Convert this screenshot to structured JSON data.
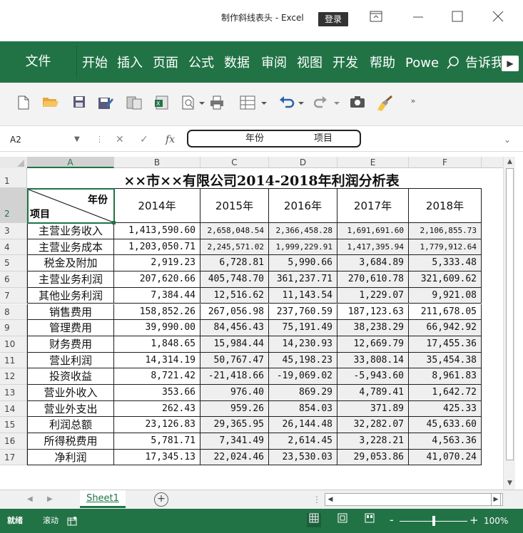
{
  "window": {
    "title": "制作斜线表头 - Excel",
    "login_label": "登录",
    "ribbon_options_icon": "ribbon-display-icon",
    "minimize_icon": "minimize-icon",
    "maximize_icon": "maximize-icon",
    "close_icon": "close-icon"
  },
  "ribbon": {
    "tabs": [
      {
        "label": "文件"
      },
      {
        "label": "开始"
      },
      {
        "label": "插入"
      },
      {
        "label": "页面"
      },
      {
        "label": "公式"
      },
      {
        "label": "数据"
      },
      {
        "label": "审阅"
      },
      {
        "label": "视图"
      },
      {
        "label": "开发"
      },
      {
        "label": "帮助"
      },
      {
        "label": "Powe"
      },
      {
        "label": "告诉我"
      }
    ],
    "search_icon": "lightbulb-search-icon",
    "scroll_right_icon": "chevron-right-icon"
  },
  "quick_toolbar": {
    "icons": [
      "new-file-icon",
      "open-folder-icon",
      "save-icon",
      "save-as-icon",
      "copy-format-icon",
      "excel-export-icon",
      "print-preview-icon",
      "print-icon",
      "table-format-icon",
      "undo-icon",
      "redo-icon",
      "camera-icon",
      "format-painter-icon",
      "more-commands-icon"
    ]
  },
  "formula_bar": {
    "name_box": "A2",
    "cancel_glyph": "✕",
    "enter_glyph": "✓",
    "fx_glyph": "fx",
    "value_part1": "年份",
    "value_part2": "项目"
  },
  "sheet": {
    "columns": [
      "A",
      "B",
      "C",
      "D",
      "E",
      "F"
    ],
    "selected_column": "A",
    "selected_row": 2,
    "title": "××市××有限公司2014-2018年利润分析表",
    "diag_header_top": "年份",
    "diag_header_bottom": "项目",
    "years": [
      "2014年",
      "2015年",
      "2016年",
      "2017年",
      "2018年"
    ],
    "rows": [
      {
        "label": "主营业务收入",
        "values": [
          "1,413,590.60",
          "2,658,048.54",
          "2,366,458.28",
          "1,691,691.60",
          "2,106,855.73"
        ]
      },
      {
        "label": "主营业务成本",
        "values": [
          "1,203,050.71",
          "2,245,571.02",
          "1,999,229.91",
          "1,417,395.94",
          "1,779,912.64"
        ]
      },
      {
        "label": "税金及附加",
        "values": [
          "2,919.23",
          "6,728.81",
          "5,990.66",
          "3,684.89",
          "5,333.48"
        ]
      },
      {
        "label": "主营业务利润",
        "values": [
          "207,620.66",
          "405,748.70",
          "361,237.71",
          "270,610.78",
          "321,609.62"
        ]
      },
      {
        "label": "其他业务利润",
        "values": [
          "7,384.44",
          "12,516.62",
          "11,143.54",
          "1,229.07",
          "9,921.08"
        ]
      },
      {
        "label": "销售费用",
        "values": [
          "158,852.26",
          "267,056.98",
          "237,760.59",
          "187,123.63",
          "211,678.05"
        ]
      },
      {
        "label": "管理费用",
        "values": [
          "39,990.00",
          "84,456.43",
          "75,191.49",
          "38,238.29",
          "66,942.92"
        ]
      },
      {
        "label": "财务费用",
        "values": [
          "1,848.65",
          "15,984.44",
          "14,230.93",
          "12,669.79",
          "17,455.36"
        ]
      },
      {
        "label": "营业利润",
        "values": [
          "14,314.19",
          "50,767.47",
          "45,198.23",
          "33,808.14",
          "35,454.38"
        ]
      },
      {
        "label": "投资收益",
        "values": [
          "8,721.42",
          "-21,418.66",
          "-19,069.02",
          "-5,943.60",
          "8,961.83"
        ]
      },
      {
        "label": "营业外收入",
        "values": [
          "353.66",
          "976.40",
          "869.29",
          "4,789.41",
          "1,642.72"
        ]
      },
      {
        "label": "营业外支出",
        "values": [
          "262.43",
          "959.26",
          "854.03",
          "371.89",
          "425.33"
        ]
      },
      {
        "label": "利润总额",
        "values": [
          "23,126.83",
          "29,365.95",
          "26,144.48",
          "32,282.07",
          "45,633.60"
        ]
      },
      {
        "label": "所得税费用",
        "values": [
          "5,781.71",
          "7,341.49",
          "2,614.45",
          "3,228.21",
          "4,563.36"
        ]
      },
      {
        "label": "净利润",
        "values": [
          "17,345.13",
          "22,024.46",
          "23,530.03",
          "29,053.86",
          "41,070.24"
        ]
      }
    ]
  },
  "sheet_tabs": {
    "tabs": [
      "Sheet1"
    ],
    "add_label": "+"
  },
  "status": {
    "mode": "就绪",
    "scroll": "滚动",
    "macro_icon": "macro-record-icon",
    "views": [
      "normal-view-icon",
      "page-layout-icon",
      "page-break-icon"
    ],
    "zoom_level": "100%",
    "zoom_fraction": 0.5
  },
  "colors": {
    "accent": "#217346",
    "status_bar": "#217346",
    "toolbar_bg": "#f3f3f3"
  }
}
